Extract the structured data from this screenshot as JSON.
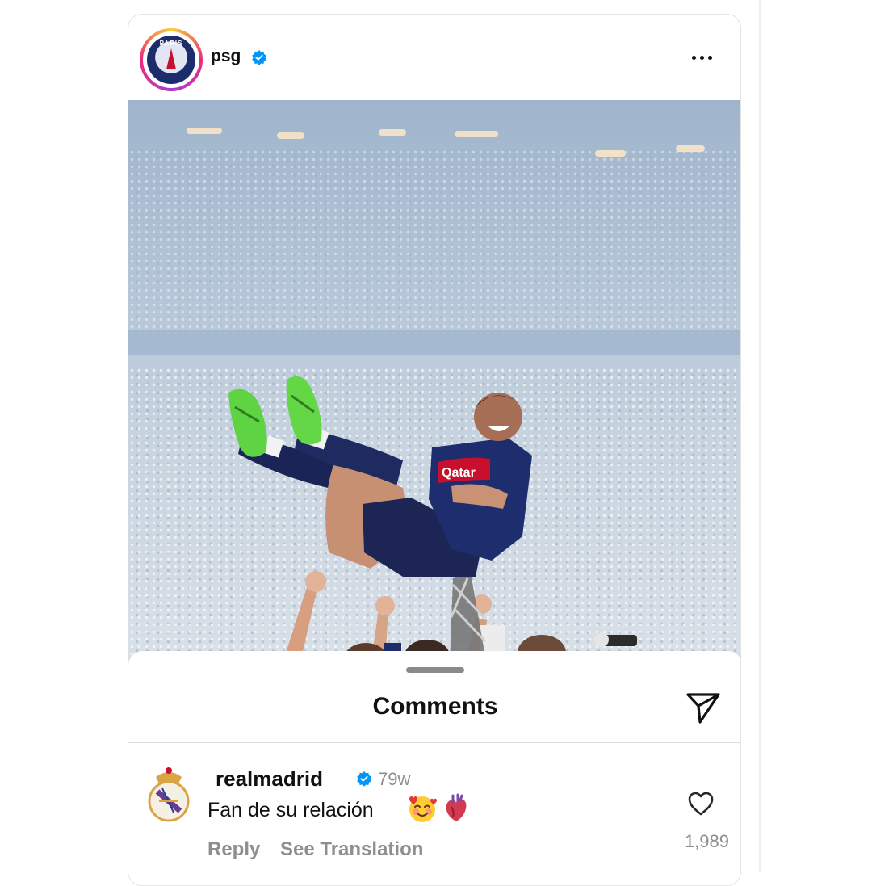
{
  "post": {
    "username": "psg",
    "verified": true,
    "avatar_icon": "psg-crest-logo",
    "avatar_text": "PARIS",
    "more_icon": "more-horizontal-icon"
  },
  "photo": {
    "description": "player-lifted-by-teammates",
    "shirt_sponsor": "Qatar"
  },
  "comments_sheet": {
    "title": "Comments",
    "share_icon": "send-icon",
    "comments": [
      {
        "username": "realmadrid",
        "verified": true,
        "avatar_icon": "real-madrid-crest-logo",
        "time": "79w",
        "text": "Fan de su relación",
        "emojis": [
          "smiling-face-with-hearts-emoji",
          "anatomical-heart-emoji"
        ],
        "reply_label": "Reply",
        "translate_label": "See Translation",
        "like_icon": "heart-outline-icon",
        "like_count": "1,989"
      }
    ]
  },
  "colors": {
    "verified_blue": "#0095f6",
    "muted_text": "#8e8e8e",
    "psg_navy": "#1c2d6b",
    "psg_red": "#c8102e",
    "boot_green": "#5ed442"
  }
}
